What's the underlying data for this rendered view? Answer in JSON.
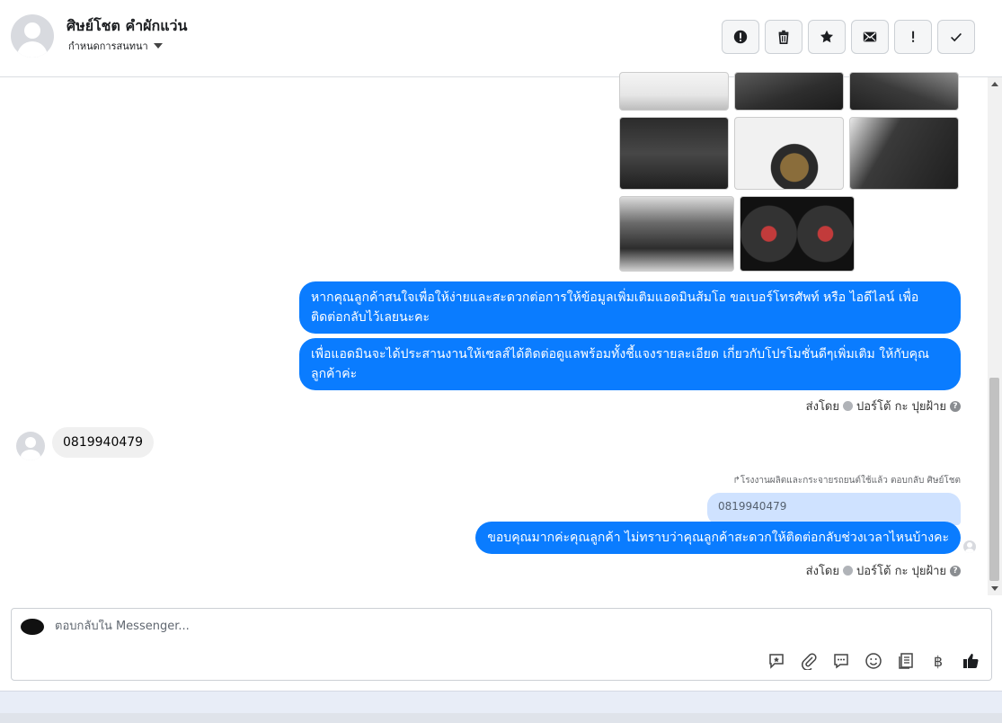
{
  "header": {
    "contact_name": "ศิษย์โชต คำผักแว่น",
    "conversation_label": "กำหนดการสนทนา",
    "toolbar": [
      {
        "name": "spam-button",
        "icon": "alert-circle-icon"
      },
      {
        "name": "delete-button",
        "icon": "trash-icon"
      },
      {
        "name": "star-button",
        "icon": "star-icon"
      },
      {
        "name": "mark-unread-button",
        "icon": "envelope-icon"
      },
      {
        "name": "important-button",
        "icon": "exclamation-icon"
      },
      {
        "name": "done-button",
        "icon": "check-icon"
      }
    ]
  },
  "messages": {
    "photos": [
      "car-exterior",
      "interior-console",
      "interior-gear",
      "rear-seats",
      "front-wheel",
      "door-panel",
      "engine-bay",
      "dashboard-gauges"
    ],
    "out1": "หากคุณลูกค้าสนใจเพื่อให้ง่ายและสะดวกต่อการให้ข้อมูลเพิ่มเติมแอดมินส้มโอ ขอเบอร์โทรศัพท์ หรือ ไอดีไลน์ เพื่อติดต่อกลับไว้เลยนะคะ",
    "out2": "เพื่อแอดมินจะได้ประสานงานให้เซลส์ได้ติดต่อดูแลพร้อมทั้งชี้แจงรายละเอียด เกี่ยวกับโปรโมชั่นดีๆเพิ่มเติม ให้กับคุณลูกค้าค่ะ",
    "sent_by_1": {
      "prefix": "ส่งโดย",
      "agent": "ปอร์โต้ กะ ปุยฝ้าย"
    },
    "in1": "0819940479",
    "reply_note": "↱โรงงานผลิตและกระจายรถยนต์ใช้แล้ว ตอบกลับ ศิษย์โชต",
    "quoted": "0819940479",
    "out3": "ขอบคุณมากค่ะคุณลูกค้า ไม่ทราบว่าคุณลูกค้าสะดวกให้ติดต่อกลับช่วงเวลาไหนบ้างคะ",
    "sent_by_2": {
      "prefix": "ส่งโดย",
      "agent": "ปอร์โต้ กะ ปุยฝ้าย"
    }
  },
  "composer": {
    "placeholder": "ตอบกลับใน Messenger...",
    "icons": [
      "saved-reply-icon",
      "attachment-icon",
      "quick-reply-icon",
      "emoji-icon",
      "catalog-icon",
      "baht-icon",
      "like-icon"
    ],
    "baht_symbol": "฿"
  },
  "colors": {
    "accent": "#0a7cff",
    "incoming_bubble": "#f0f0f0",
    "quoted_bubble": "#cfe2ff"
  }
}
